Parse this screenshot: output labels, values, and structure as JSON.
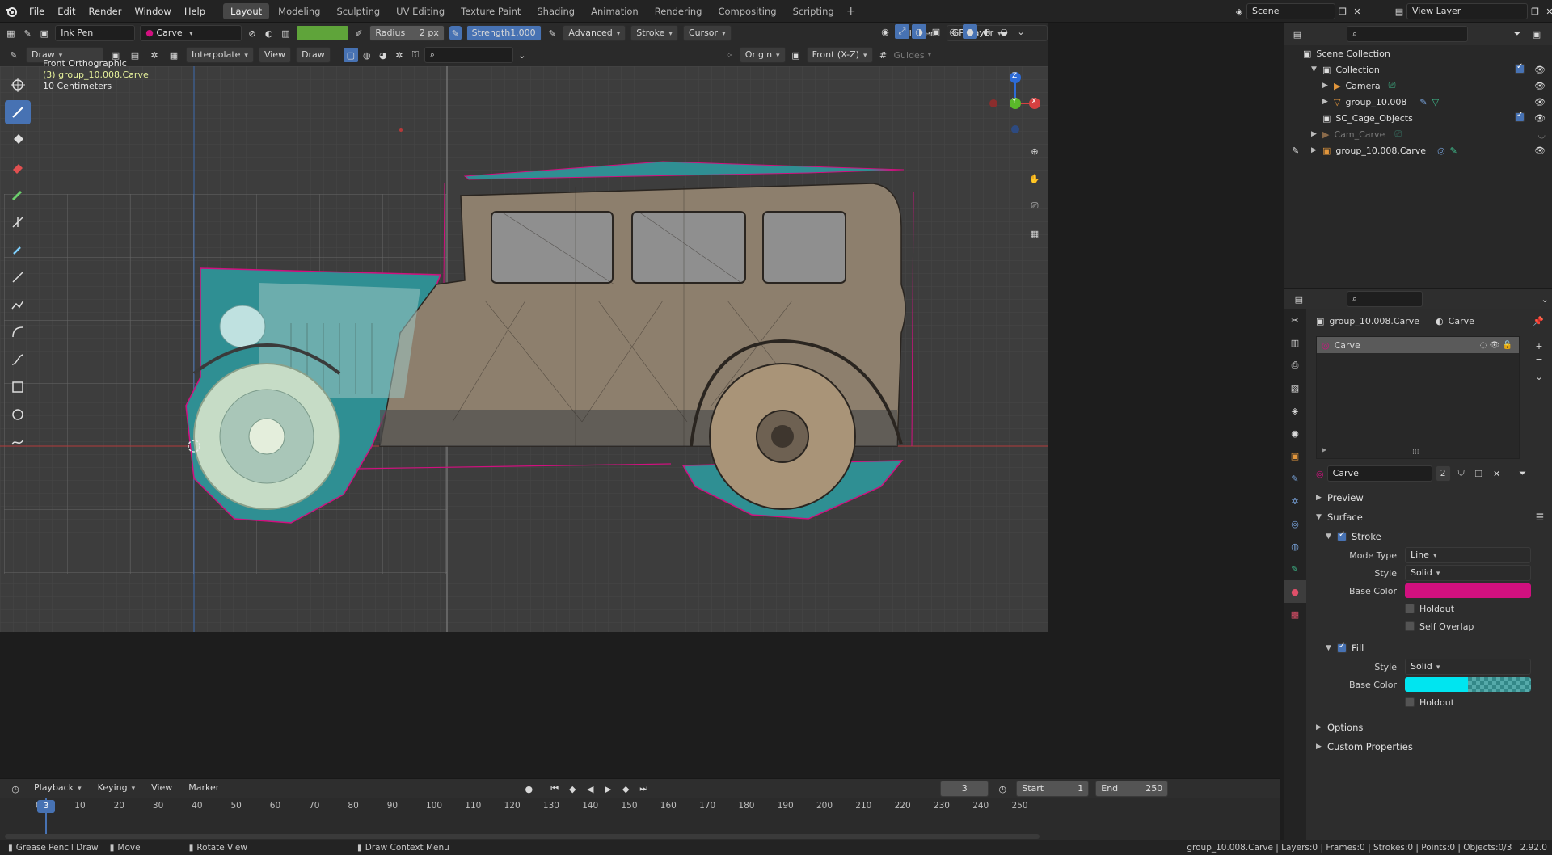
{
  "menu": {
    "file": "File",
    "edit": "Edit",
    "render": "Render",
    "window": "Window",
    "help": "Help"
  },
  "workspaces": [
    "Layout",
    "Modeling",
    "Sculpting",
    "UV Editing",
    "Texture Paint",
    "Shading",
    "Animation",
    "Rendering",
    "Compositing",
    "Scripting"
  ],
  "active_workspace": "Layout",
  "scene": {
    "name": "Scene",
    "view_layer": "View Layer"
  },
  "tool_header": {
    "brush": "Ink Pen",
    "material": "Carve",
    "radius_label": "Radius",
    "radius_value": "2 px",
    "strength_label": "Strength",
    "strength_value": "1.000",
    "advanced": "Advanced",
    "stroke": "Stroke",
    "cursor": "Cursor",
    "layer_label": "Layer:",
    "layer_value": "GP_Layer"
  },
  "viewport_header": {
    "mode": "Draw",
    "interpolate": "Interpolate",
    "view": "View",
    "draw": "Draw",
    "origin": "Origin",
    "plane": "Front (X-Z)",
    "guides": "Guides"
  },
  "viewport_overlay": {
    "view_name": "Front Orthographic",
    "object": "(3) group_10.008.Carve",
    "scale": "10 Centimeters"
  },
  "gizmo": {
    "z": "Z",
    "y": "Y",
    "x": "X"
  },
  "outliner": {
    "root": "Scene Collection",
    "items": [
      {
        "name": "Collection",
        "depth": 1
      },
      {
        "name": "Camera",
        "depth": 2
      },
      {
        "name": "group_10.008",
        "depth": 2
      },
      {
        "name": "SC_Cage_Objects",
        "depth": 1
      },
      {
        "name": "Cam_Carve",
        "depth": 1
      },
      {
        "name": "group_10.008.Carve",
        "depth": 1
      }
    ]
  },
  "properties": {
    "object_name": "group_10.008.Carve",
    "material_name": "Carve",
    "slot_name": "Carve",
    "material_field": "Carve",
    "users": "2",
    "preview": "Preview",
    "surface": "Surface",
    "stroke": {
      "label": "Stroke",
      "mode_type_label": "Mode Type",
      "mode_type": "Line",
      "style_label": "Style",
      "style": "Solid",
      "base_color_label": "Base Color",
      "base_color": "#d1107f",
      "holdout": "Holdout",
      "self_overlap": "Self Overlap"
    },
    "fill": {
      "label": "Fill",
      "style_label": "Style",
      "style": "Solid",
      "base_color_label": "Base Color",
      "base_color": "#00e5f0",
      "holdout": "Holdout"
    },
    "options": "Options",
    "custom_properties": "Custom Properties"
  },
  "timeline": {
    "playback": "Playback",
    "keying": "Keying",
    "view": "View",
    "marker": "Marker",
    "current_frame": "3",
    "start_label": "Start",
    "start": "1",
    "end_label": "End",
    "end": "250",
    "ticks": [
      "0",
      "10",
      "20",
      "30",
      "40",
      "50",
      "60",
      "70",
      "80",
      "90",
      "100",
      "110",
      "120",
      "130",
      "140",
      "150",
      "160",
      "170",
      "180",
      "190",
      "200",
      "210",
      "220",
      "230",
      "240",
      "250"
    ]
  },
  "statusbar": {
    "mode": "Grease Pencil Draw",
    "move": "Move",
    "rotate": "Rotate View",
    "context": "Draw Context Menu",
    "stats": "group_10.008.Carve | Layers:0 | Frames:0 | Strokes:0 | Points:0 | Objects:0/3 | 2.92.0"
  },
  "colors": {
    "accent": "#4772b3",
    "stroke_magenta": "#d1107f",
    "fill_teal": "#2f8f93",
    "viewport_bg": "#3d3d3d"
  }
}
